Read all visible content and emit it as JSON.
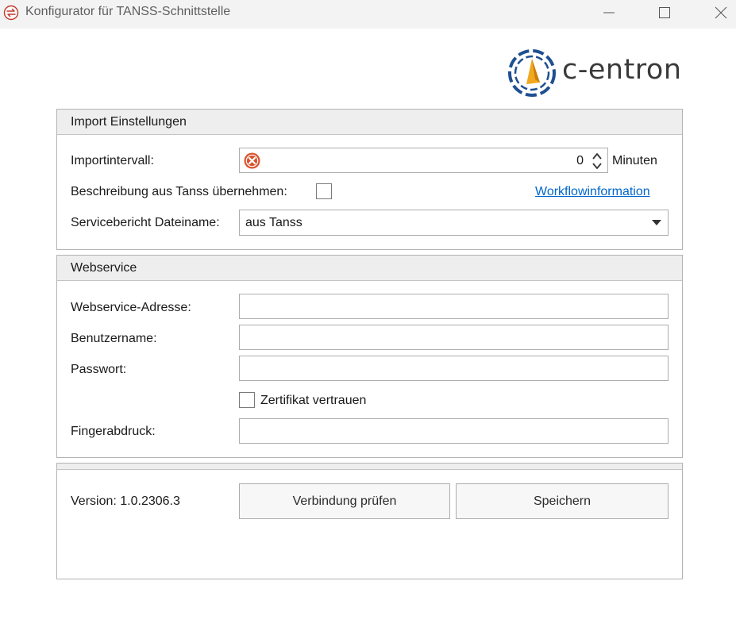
{
  "window": {
    "title": "Konfigurator für TANSS-Schnittstelle",
    "icon": "sync-arrows-icon",
    "controls": [
      "minimize-icon",
      "maximize-icon",
      "close-icon"
    ]
  },
  "logo": {
    "text": "c-entron",
    "accent_colors": [
      "#1e4f91",
      "#f0a81e"
    ]
  },
  "import_section": {
    "header": "Import Einstellungen",
    "interval_label": "Importintervall:",
    "interval_value": "0",
    "interval_unit": "Minuten",
    "interval_error_icon": "error-x-icon",
    "description_label": "Beschreibung aus Tanss übernehmen:",
    "description_checked": false,
    "workflow_link": "Workflowinformation",
    "filename_label": "Servicebericht Dateiname:",
    "filename_value": "aus Tanss"
  },
  "webservice_section": {
    "header": "Webservice",
    "address_label": "Webservice-Adresse:",
    "address_value": "",
    "user_label": "Benutzername:",
    "user_value": "",
    "password_label": "Passwort:",
    "password_value": "",
    "cert_label": "Zertifikat vertrauen",
    "cert_checked": false,
    "fingerprint_label": "Fingerabdruck:",
    "fingerprint_value": ""
  },
  "footer_section": {
    "version": "Version: 1.0.2306.3",
    "check_button": "Verbindung prüfen",
    "save_button": "Speichern"
  }
}
